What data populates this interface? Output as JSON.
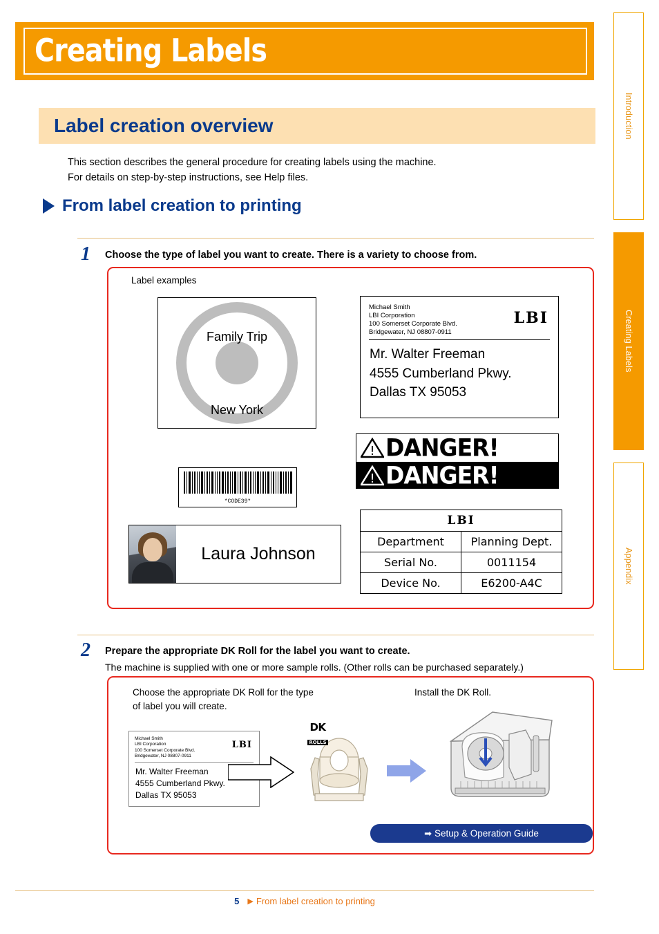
{
  "header": {
    "title": "Creating Labels"
  },
  "section": {
    "title": "Label creation overview",
    "intro_line1": "This section describes the general procedure for creating labels using the machine.",
    "intro_line2": "For details on step-by-step instructions, see Help files.",
    "subheading": "From label creation to printing"
  },
  "steps": [
    {
      "number": "1",
      "title": "Choose the type of label you want to create. There is a variety to choose from.",
      "box_label": "Label examples"
    },
    {
      "number": "2",
      "title": "Prepare the appropriate DK Roll  for the label you want to create.",
      "subtitle": "The machine is supplied with one or more sample rolls. (Other rolls can be purchased separately.)",
      "left_caption_line1": "Choose the appropriate DK Roll  for the type",
      "left_caption_line2": "of label you will create.",
      "right_caption": "Install the DK Roll.",
      "guide_button": "Setup & Operation Guide",
      "guide_button_arrow": "➡"
    }
  ],
  "examples": {
    "cd": {
      "line1": "Family Trip",
      "line2": "New York"
    },
    "address": {
      "small_lines": [
        "Michael Smith",
        "LBI Corporation",
        "100 Somerset Corporate Blvd.",
        "Bridgewater, NJ 08807-0911"
      ],
      "logo": "LBI",
      "big_lines": [
        "Mr. Walter Freeman",
        "4555 Cumberland Pkwy.",
        "Dallas TX 95053"
      ]
    },
    "barcode": {
      "text": "*CODE39*"
    },
    "danger": {
      "word": "DANGER!"
    },
    "photo_id": {
      "name": "Laura Johnson"
    },
    "table": {
      "logo": "LBI",
      "rows": [
        {
          "key": "Department",
          "value": "Planning Dept."
        },
        {
          "key": "Serial No.",
          "value": "0011154"
        },
        {
          "key": "Device No.",
          "value": "E6200-A4C"
        }
      ]
    },
    "mini_address": {
      "small_lines": [
        "Michael Smith",
        "LBI Corporation",
        "100 Somerset Corporate Blvd.",
        "Bridgewater, NJ 08807-0911"
      ],
      "logo": "LBI",
      "big_lines": [
        "Mr. Walter Freeman",
        "4555 Cumberland Pkwy.",
        "Dallas TX 95053"
      ]
    },
    "dk_badge": {
      "line1": "DK",
      "line2": "ROLLS"
    }
  },
  "side_tabs": [
    {
      "label": "Introduction",
      "active": false
    },
    {
      "label": "Creating Labels",
      "active": true
    },
    {
      "label": "Appendix",
      "active": false
    }
  ],
  "footer": {
    "page_number": "5",
    "arrow": "▶",
    "text": "From label creation to printing"
  },
  "colors": {
    "orange": "#f59a00",
    "peach": "#fde0b2",
    "navy": "#0a3a8c",
    "red": "#e8281e",
    "tab_orange": "#e8971a"
  }
}
